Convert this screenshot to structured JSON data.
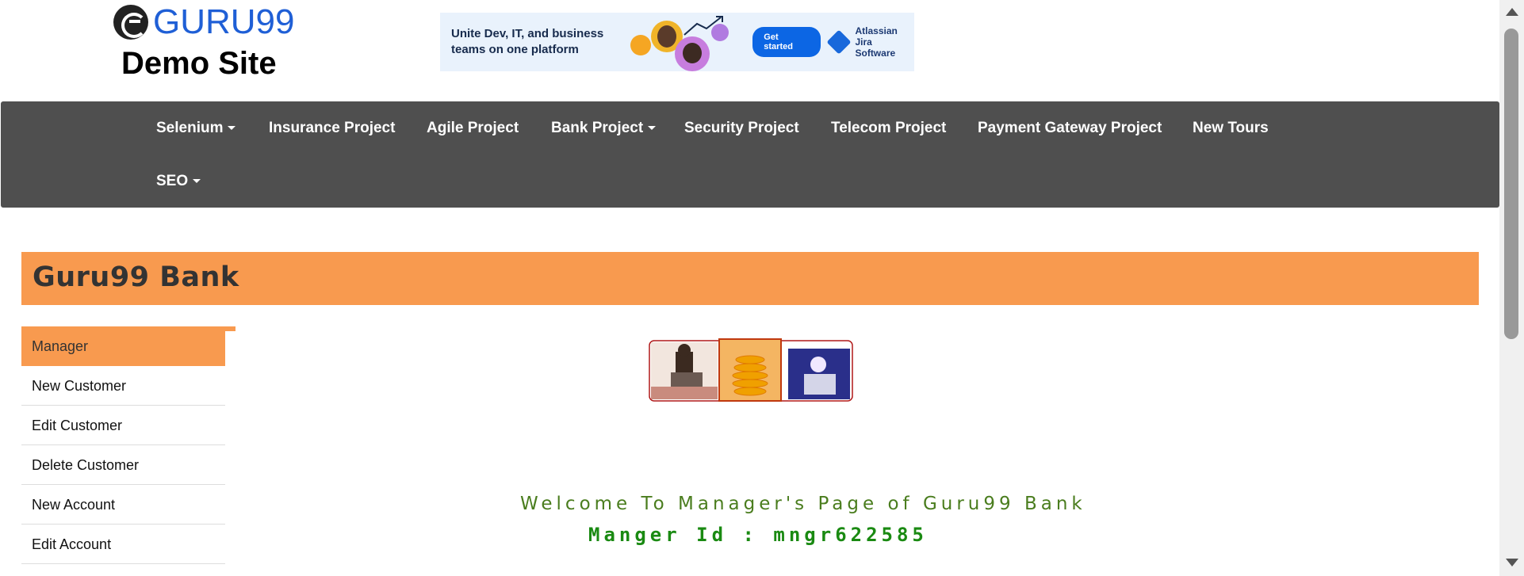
{
  "header": {
    "logo_text": "GURU99",
    "logo_subtitle": "Demo Site",
    "ad": {
      "headline": "Unite Dev, IT, and business teams on one platform",
      "button_label": "Get started",
      "brand_line1": "Atlassian",
      "brand_line2": "Jira Software"
    }
  },
  "nav": {
    "items": [
      {
        "label": "Selenium",
        "dropdown": true
      },
      {
        "label": "Insurance Project",
        "dropdown": false
      },
      {
        "label": "Agile Project",
        "dropdown": false
      },
      {
        "label": "Bank Project",
        "dropdown": true
      },
      {
        "label": "Security Project",
        "dropdown": false
      },
      {
        "label": "Telecom Project",
        "dropdown": false
      },
      {
        "label": "Payment Gateway Project",
        "dropdown": false
      },
      {
        "label": "New Tours",
        "dropdown": false
      },
      {
        "label": "SEO",
        "dropdown": true
      }
    ]
  },
  "page": {
    "title": "Guru99 Bank",
    "welcome": "Welcome To Manager's Page of Guru99 Bank",
    "manager_id": "Manger Id : mngr622585"
  },
  "sidebar": {
    "items": [
      {
        "label": "Manager",
        "active": true
      },
      {
        "label": "New Customer",
        "active": false
      },
      {
        "label": "Edit Customer",
        "active": false
      },
      {
        "label": "Delete Customer",
        "active": false
      },
      {
        "label": "New Account",
        "active": false
      },
      {
        "label": "Edit Account",
        "active": false
      }
    ]
  },
  "colors": {
    "accent_orange": "#f89a4f",
    "navbar_bg": "#4f4f4f",
    "welcome_green": "#4a7d1e",
    "manager_green": "#1a8a12",
    "logo_blue": "#1f5fd6"
  }
}
